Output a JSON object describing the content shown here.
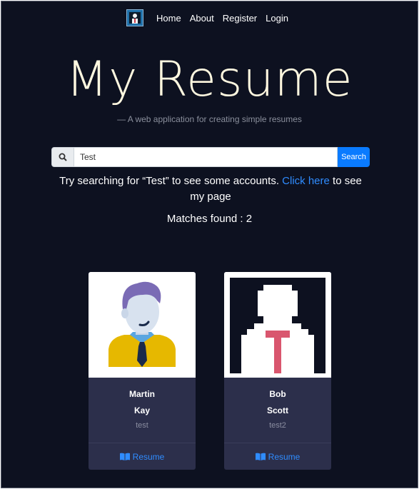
{
  "nav": {
    "items": [
      "Home",
      "About",
      "Register",
      "Login"
    ]
  },
  "hero": {
    "title": "My Resume",
    "subtitle": "— A web application for creating simple resumes"
  },
  "search": {
    "value": "Test",
    "button": "Search"
  },
  "hint": {
    "before": "Try searching for “Test” to see some accounts. ",
    "link": "Click here",
    "after": " to see my page"
  },
  "matches": "Matches found : 2",
  "cards": [
    {
      "first": "Martin",
      "last": "Kay",
      "username": "test",
      "action": "Resume"
    },
    {
      "first": "Bob",
      "last": "Scott",
      "username": "test2",
      "action": "Resume"
    }
  ],
  "colors": {
    "background": "#0d1120",
    "accent": "#0a7bff",
    "card": "#2c2f4b",
    "title": "#fff8e0"
  }
}
